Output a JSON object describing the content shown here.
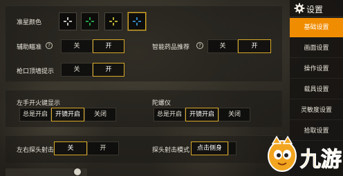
{
  "crosshair": {
    "label": "准星颜色",
    "options": [
      {
        "color": "#ffffff",
        "selected": false
      },
      {
        "color": "#2fd35a",
        "selected": false
      },
      {
        "color": "#f0e040",
        "selected": false
      },
      {
        "color": "#3fb0ff",
        "selected": true
      }
    ]
  },
  "aim_assist": {
    "label": "辅助瞄准",
    "help": "?",
    "off": "关",
    "on": "开",
    "selected": "on"
  },
  "smart_meds": {
    "label": "智能药品推荐",
    "help": "?",
    "off": "关",
    "on": "开",
    "selected": "on"
  },
  "gun_wall": {
    "label": "枪口顶墙提示",
    "off": "关",
    "on": "开",
    "selected": "on"
  },
  "left_fire": {
    "label": "左手开火键显示",
    "options": [
      "总是开启",
      "开镜开启",
      "关闭"
    ],
    "selected_index": 1
  },
  "gyroscope": {
    "label": "陀螺仪",
    "options": [
      "总是开启",
      "开镜开启",
      "关闭"
    ],
    "selected_index": 1
  },
  "lean_fire": {
    "label": "左右探头射击",
    "off": "关",
    "on": "开",
    "selected": "off"
  },
  "lean_mode": {
    "label": "探头射击模式",
    "option": "点击侧身"
  },
  "menu": {
    "title": "设置",
    "icon": "gear-icon",
    "items": [
      "基础设置",
      "画面设置",
      "操作设置",
      "载具设置",
      "灵敏度设置",
      "拾取设置"
    ],
    "active_index": 0,
    "accent": "#f08c00"
  },
  "watermark": {
    "text": "九游"
  }
}
